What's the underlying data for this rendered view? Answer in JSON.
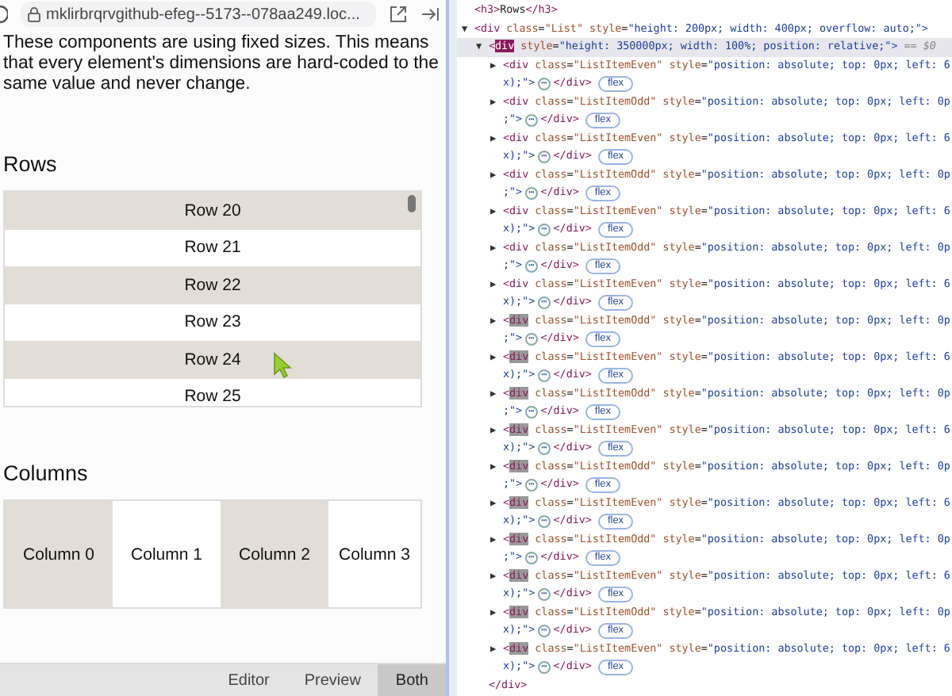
{
  "address_bar": {
    "url": "mklirbrqrvgithub-efeg--5173--078aa249.loc..."
  },
  "preview": {
    "intro": "These components are using fixed sizes. This means that every element's dimensions are hard-coded to the same value and never change.",
    "rows_heading": "Rows",
    "rows": [
      {
        "label": "Row 20",
        "shaded": true
      },
      {
        "label": "Row 21",
        "shaded": false
      },
      {
        "label": "Row 22",
        "shaded": true
      },
      {
        "label": "Row 23",
        "shaded": false
      },
      {
        "label": "Row 24",
        "shaded": true
      },
      {
        "label": "Row 25",
        "shaded": false
      }
    ],
    "columns_heading": "Columns",
    "columns": [
      {
        "label": "Column 0",
        "shaded": true
      },
      {
        "label": "Column 1",
        "shaded": false
      },
      {
        "label": "Column 2",
        "shaded": true
      },
      {
        "label": "Column 3",
        "shaded": false
      }
    ]
  },
  "view_tabs": [
    {
      "label": "Editor",
      "selected": false
    },
    {
      "label": "Preview",
      "selected": false
    },
    {
      "label": "Both",
      "selected": true
    }
  ],
  "devtools": {
    "nodes": [
      {
        "selected": false,
        "tokens": [
          {
            "text": "<h3>",
            "kind": "tag"
          },
          {
            "text": "Rows",
            "kind": "plain"
          },
          {
            "text": "</h3>",
            "kind": "tag"
          }
        ]
      },
      {
        "toggle": "▼",
        "expanded": true,
        "selected": false,
        "tokens": [
          {
            "text": "<div",
            "kind": "tag"
          },
          {
            "text": " class",
            "kind": "attr"
          },
          {
            "text": "=",
            "kind": "plain"
          },
          {
            "text": "\"List\"",
            "kind": "attr_value"
          },
          {
            "text": " style",
            "kind": "attr"
          },
          {
            "text": "=",
            "kind": "plain"
          },
          {
            "text": "\"height: 200px; width: 400px; overflow: auto;\">",
            "kind": "value"
          }
        ],
        "children": [
          {
            "toggle": "▼",
            "expanded": true,
            "selected": true,
            "tokens": [
              {
                "text": "<",
                "kind": "tag"
              },
              {
                "text": "div",
                "kind": "tag_selected"
              },
              {
                "text": " style",
                "kind": "attr"
              },
              {
                "text": "=",
                "kind": "plain"
              },
              {
                "text": "\"height: 350000px; width: 100%; position: relative;\">",
                "kind": "value"
              },
              {
                "text": " == $0",
                "kind": "ref"
              }
            ],
            "children": [
              {
                "toggle": "▶",
                "expanded": false,
                "selected": false,
                "tokens": [
                  {
                    "text": "<div",
                    "kind": "tag"
                  },
                  {
                    "text": " class",
                    "kind": "attr"
                  },
                  {
                    "text": "=",
                    "kind": "plain"
                  },
                  {
                    "text": "\"ListItemEven\"",
                    "kind": "attr_value"
                  },
                  {
                    "text": " style",
                    "kind": "attr"
                  },
                  {
                    "text": "=",
                    "kind": "plain"
                  },
                  {
                    "text": "\"position: absolute; top: 0px; left: 6",
                    "kind": "value"
                  }
                ],
                "tail": {
                  "code": "x);\">",
                  "ellipsis": "⋯",
                  "close": "</div>",
                  "badge": "flex"
                }
              },
              {
                "toggle": "▶",
                "expanded": false,
                "selected": false,
                "tokens": [
                  {
                    "text": "<div",
                    "kind": "tag"
                  },
                  {
                    "text": " class",
                    "kind": "attr"
                  },
                  {
                    "text": "=",
                    "kind": "plain"
                  },
                  {
                    "text": "\"ListItemOdd\"",
                    "kind": "attr_value"
                  },
                  {
                    "text": " style",
                    "kind": "attr"
                  },
                  {
                    "text": "=",
                    "kind": "plain"
                  },
                  {
                    "text": "\"position: absolute; top: 0px; left: 0p",
                    "kind": "value"
                  }
                ],
                "tail": {
                  "code": ";\">",
                  "ellipsis": "⋯",
                  "close": "</div>",
                  "badge": "flex"
                }
              },
              {
                "toggle": "▶",
                "expanded": false,
                "selected": false,
                "tokens": [
                  {
                    "text": "<div",
                    "kind": "tag"
                  },
                  {
                    "text": " class",
                    "kind": "attr"
                  },
                  {
                    "text": "=",
                    "kind": "plain"
                  },
                  {
                    "text": "\"ListItemEven\"",
                    "kind": "attr_value"
                  },
                  {
                    "text": " style",
                    "kind": "attr"
                  },
                  {
                    "text": "=",
                    "kind": "plain"
                  },
                  {
                    "text": "\"position: absolute; top: 0px; left: 6",
                    "kind": "value"
                  }
                ],
                "tail": {
                  "code": "x);\">",
                  "ellipsis": "⋯",
                  "close": "</div>",
                  "badge": "flex"
                }
              },
              {
                "toggle": "▶",
                "expanded": false,
                "selected": false,
                "tokens": [
                  {
                    "text": "<div",
                    "kind": "tag"
                  },
                  {
                    "text": " class",
                    "kind": "attr"
                  },
                  {
                    "text": "=",
                    "kind": "plain"
                  },
                  {
                    "text": "\"ListItemOdd\"",
                    "kind": "attr_value"
                  },
                  {
                    "text": " style",
                    "kind": "attr"
                  },
                  {
                    "text": "=",
                    "kind": "plain"
                  },
                  {
                    "text": "\"position: absolute; top: 0px; left: 0p",
                    "kind": "value"
                  }
                ],
                "tail": {
                  "code": ";\">",
                  "ellipsis": "⋯",
                  "close": "</div>",
                  "badge": "flex"
                }
              },
              {
                "toggle": "▶",
                "expanded": false,
                "selected": false,
                "tokens": [
                  {
                    "text": "<div",
                    "kind": "tag"
                  },
                  {
                    "text": " class",
                    "kind": "attr"
                  },
                  {
                    "text": "=",
                    "kind": "plain"
                  },
                  {
                    "text": "\"ListItemEven\"",
                    "kind": "attr_value"
                  },
                  {
                    "text": " style",
                    "kind": "attr"
                  },
                  {
                    "text": "=",
                    "kind": "plain"
                  },
                  {
                    "text": "\"position: absolute; top: 0px; left: 6",
                    "kind": "value"
                  }
                ],
                "tail": {
                  "code": "x);\">",
                  "ellipsis": "⋯",
                  "close": "</div>",
                  "badge": "flex"
                }
              },
              {
                "toggle": "▶",
                "expanded": false,
                "selected": false,
                "tokens": [
                  {
                    "text": "<div",
                    "kind": "tag"
                  },
                  {
                    "text": " class",
                    "kind": "attr"
                  },
                  {
                    "text": "=",
                    "kind": "plain"
                  },
                  {
                    "text": "\"ListItemOdd\"",
                    "kind": "attr_value"
                  },
                  {
                    "text": " style",
                    "kind": "attr"
                  },
                  {
                    "text": "=",
                    "kind": "plain"
                  },
                  {
                    "text": "\"position: absolute; top: 0px; left: 0p",
                    "kind": "value"
                  }
                ],
                "tail": {
                  "code": ";\">",
                  "ellipsis": "⋯",
                  "close": "</div>",
                  "badge": "flex"
                }
              },
              {
                "toggle": "▶",
                "expanded": false,
                "selected": false,
                "tokens": [
                  {
                    "text": "<div",
                    "kind": "tag"
                  },
                  {
                    "text": " class",
                    "kind": "attr"
                  },
                  {
                    "text": "=",
                    "kind": "plain"
                  },
                  {
                    "text": "\"ListItemEven\"",
                    "kind": "attr_value"
                  },
                  {
                    "text": " style",
                    "kind": "attr"
                  },
                  {
                    "text": "=",
                    "kind": "plain"
                  },
                  {
                    "text": "\"position: absolute; top: 0px; left: 6",
                    "kind": "value"
                  }
                ],
                "tail": {
                  "code": "x);\">",
                  "ellipsis": "⋯",
                  "close": "</div>",
                  "badge": "flex"
                }
              },
              {
                "toggle": "▶",
                "expanded": false,
                "selected": false,
                "tokens": [
                  {
                    "text": "<",
                    "kind": "tag"
                  },
                  {
                    "text": "div",
                    "kind": "tag_flash"
                  },
                  {
                    "text": " class",
                    "kind": "attr"
                  },
                  {
                    "text": "=",
                    "kind": "plain"
                  },
                  {
                    "text": "\"ListItemOdd\"",
                    "kind": "attr_value"
                  },
                  {
                    "text": " style",
                    "kind": "attr"
                  },
                  {
                    "text": "=",
                    "kind": "plain"
                  },
                  {
                    "text": "\"position: absolute; top: 0px; left: 0p",
                    "kind": "value"
                  }
                ],
                "tail": {
                  "code": ";\">",
                  "ellipsis": "⋯",
                  "close": "</div>",
                  "badge": "flex"
                }
              },
              {
                "toggle": "▶",
                "expanded": false,
                "selected": false,
                "tokens": [
                  {
                    "text": "<",
                    "kind": "tag"
                  },
                  {
                    "text": "div",
                    "kind": "tag_flash"
                  },
                  {
                    "text": " class",
                    "kind": "attr"
                  },
                  {
                    "text": "=",
                    "kind": "plain"
                  },
                  {
                    "text": "\"ListItemEven\"",
                    "kind": "attr_value"
                  },
                  {
                    "text": " style",
                    "kind": "attr"
                  },
                  {
                    "text": "=",
                    "kind": "plain"
                  },
                  {
                    "text": "\"position: absolute; top: 0px; left: 6",
                    "kind": "value"
                  }
                ],
                "tail": {
                  "code": "x);\">",
                  "ellipsis": "⋯",
                  "close": "</div>",
                  "badge": "flex"
                }
              },
              {
                "toggle": "▶",
                "expanded": false,
                "selected": false,
                "tokens": [
                  {
                    "text": "<",
                    "kind": "tag"
                  },
                  {
                    "text": "div",
                    "kind": "tag_flash"
                  },
                  {
                    "text": " class",
                    "kind": "attr"
                  },
                  {
                    "text": "=",
                    "kind": "plain"
                  },
                  {
                    "text": "\"ListItemOdd\"",
                    "kind": "attr_value"
                  },
                  {
                    "text": " style",
                    "kind": "attr"
                  },
                  {
                    "text": "=",
                    "kind": "plain"
                  },
                  {
                    "text": "\"position: absolute; top: 0px; left: 0p",
                    "kind": "value"
                  }
                ],
                "tail": {
                  "code": ";\">",
                  "ellipsis": "⋯",
                  "close": "</div>",
                  "badge": "flex"
                }
              },
              {
                "toggle": "▶",
                "expanded": false,
                "selected": false,
                "tokens": [
                  {
                    "text": "<",
                    "kind": "tag"
                  },
                  {
                    "text": "div",
                    "kind": "tag_flash"
                  },
                  {
                    "text": " class",
                    "kind": "attr"
                  },
                  {
                    "text": "=",
                    "kind": "plain"
                  },
                  {
                    "text": "\"ListItemEven\"",
                    "kind": "attr_value"
                  },
                  {
                    "text": " style",
                    "kind": "attr"
                  },
                  {
                    "text": "=",
                    "kind": "plain"
                  },
                  {
                    "text": "\"position: absolute; top: 0px; left: 6",
                    "kind": "value"
                  }
                ],
                "tail": {
                  "code": "x);\">",
                  "ellipsis": "⋯",
                  "close": "</div>",
                  "badge": "flex"
                }
              },
              {
                "toggle": "▶",
                "expanded": false,
                "selected": false,
                "tokens": [
                  {
                    "text": "<",
                    "kind": "tag"
                  },
                  {
                    "text": "div",
                    "kind": "tag_flash"
                  },
                  {
                    "text": " class",
                    "kind": "attr"
                  },
                  {
                    "text": "=",
                    "kind": "plain"
                  },
                  {
                    "text": "\"ListItemOdd\"",
                    "kind": "attr_value"
                  },
                  {
                    "text": " style",
                    "kind": "attr"
                  },
                  {
                    "text": "=",
                    "kind": "plain"
                  },
                  {
                    "text": "\"position: absolute; top: 0px; left: 0p",
                    "kind": "value"
                  }
                ],
                "tail": {
                  "code": ";\">",
                  "ellipsis": "⋯",
                  "close": "</div>",
                  "badge": "flex"
                }
              },
              {
                "toggle": "▶",
                "expanded": false,
                "selected": false,
                "tokens": [
                  {
                    "text": "<",
                    "kind": "tag"
                  },
                  {
                    "text": "div",
                    "kind": "tag_flash"
                  },
                  {
                    "text": " class",
                    "kind": "attr"
                  },
                  {
                    "text": "=",
                    "kind": "plain"
                  },
                  {
                    "text": "\"ListItemEven\"",
                    "kind": "attr_value"
                  },
                  {
                    "text": " style",
                    "kind": "attr"
                  },
                  {
                    "text": "=",
                    "kind": "plain"
                  },
                  {
                    "text": "\"position: absolute; top: 0px; left: 6",
                    "kind": "value"
                  }
                ],
                "tail": {
                  "code": "x);\">",
                  "ellipsis": "⋯",
                  "close": "</div>",
                  "badge": "flex"
                }
              },
              {
                "toggle": "▶",
                "expanded": false,
                "selected": false,
                "tokens": [
                  {
                    "text": "<",
                    "kind": "tag"
                  },
                  {
                    "text": "div",
                    "kind": "tag_flash"
                  },
                  {
                    "text": " class",
                    "kind": "attr"
                  },
                  {
                    "text": "=",
                    "kind": "plain"
                  },
                  {
                    "text": "\"ListItemOdd\"",
                    "kind": "attr_value"
                  },
                  {
                    "text": " style",
                    "kind": "attr"
                  },
                  {
                    "text": "=",
                    "kind": "plain"
                  },
                  {
                    "text": "\"position: absolute; top: 0px; left: 0p",
                    "kind": "value"
                  }
                ],
                "tail": {
                  "code": ";\">",
                  "ellipsis": "⋯",
                  "close": "</div>",
                  "badge": "flex"
                }
              },
              {
                "toggle": "▶",
                "expanded": false,
                "selected": false,
                "tokens": [
                  {
                    "text": "<",
                    "kind": "tag"
                  },
                  {
                    "text": "div",
                    "kind": "tag_flash"
                  },
                  {
                    "text": " class",
                    "kind": "attr"
                  },
                  {
                    "text": "=",
                    "kind": "plain"
                  },
                  {
                    "text": "\"ListItemEven\"",
                    "kind": "attr_value"
                  },
                  {
                    "text": " style",
                    "kind": "attr"
                  },
                  {
                    "text": "=",
                    "kind": "plain"
                  },
                  {
                    "text": "\"position: absolute; top: 0px; left: 6",
                    "kind": "value"
                  }
                ],
                "tail": {
                  "code": "x);\">",
                  "ellipsis": "⋯",
                  "close": "</div>",
                  "badge": "flex"
                }
              },
              {
                "toggle": "▶",
                "expanded": false,
                "selected": false,
                "tokens": [
                  {
                    "text": "<",
                    "kind": "tag"
                  },
                  {
                    "text": "div",
                    "kind": "tag_flash"
                  },
                  {
                    "text": " class",
                    "kind": "attr"
                  },
                  {
                    "text": "=",
                    "kind": "plain"
                  },
                  {
                    "text": "\"ListItemOdd\"",
                    "kind": "attr_value"
                  },
                  {
                    "text": " style",
                    "kind": "attr"
                  },
                  {
                    "text": "=",
                    "kind": "plain"
                  },
                  {
                    "text": "\"position: absolute; top: 0px; left: 0p",
                    "kind": "value"
                  }
                ],
                "tail": {
                  "code": "x);\">",
                  "ellipsis": "⋯",
                  "close": "</div>",
                  "badge": "flex"
                }
              },
              {
                "toggle": "▶",
                "expanded": false,
                "selected": false,
                "tokens": [
                  {
                    "text": "<",
                    "kind": "tag"
                  },
                  {
                    "text": "div",
                    "kind": "tag_flash"
                  },
                  {
                    "text": " class",
                    "kind": "attr"
                  },
                  {
                    "text": "=",
                    "kind": "plain"
                  },
                  {
                    "text": "\"ListItemEven\"",
                    "kind": "attr_value"
                  },
                  {
                    "text": " style",
                    "kind": "attr"
                  },
                  {
                    "text": "=",
                    "kind": "plain"
                  },
                  {
                    "text": "\"position: absolute; top: 0px; left: 6",
                    "kind": "value"
                  }
                ],
                "tail": {
                  "code": "x);\">",
                  "ellipsis": "⋯",
                  "close": "</div>",
                  "badge": "flex"
                }
              }
            ],
            "closing": "</div>"
          }
        ]
      }
    ]
  }
}
